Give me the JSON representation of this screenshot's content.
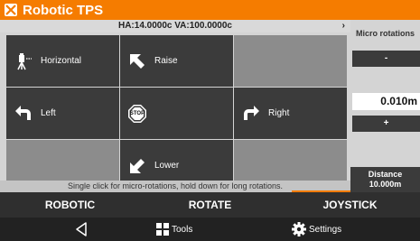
{
  "app": {
    "title": "Robotic TPS",
    "accent": "#f57c00"
  },
  "angles": {
    "text": "HA:14.0000c VA:100.0000c",
    "chevron": "›"
  },
  "grid": {
    "horizontal": "Horizontal",
    "raise": "Raise",
    "left": "Left",
    "stop": "STOP",
    "right": "Right",
    "lower": "Lower"
  },
  "side": {
    "label": "Micro rotations",
    "minus": "-",
    "value": "0.010m",
    "plus": "+",
    "distance_label": "Distance",
    "distance_value": "10.000m"
  },
  "hint": "Single click for micro-rotations, hold down for long rotations.",
  "tabs": [
    "ROBOTIC",
    "ROTATE",
    "JOYSTICK"
  ],
  "nav": {
    "tools": "Tools",
    "settings": "Settings"
  }
}
